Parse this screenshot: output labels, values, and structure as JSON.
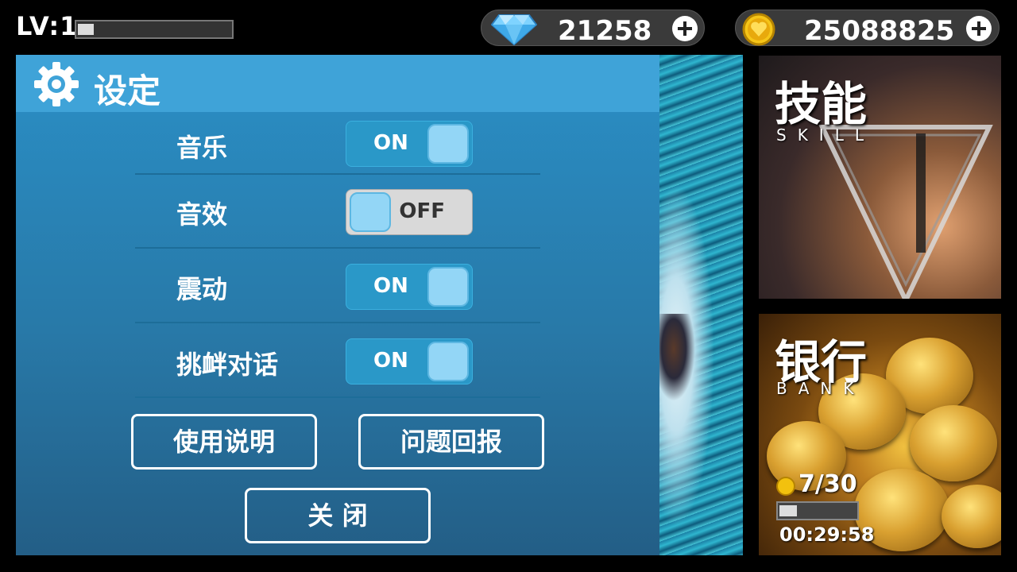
{
  "hud": {
    "level_label": "LV:1",
    "level_progress": 0.1,
    "gems": {
      "icon": "diamond-icon",
      "value": "21258"
    },
    "coins": {
      "icon": "heart-coin-icon",
      "value": "25088825"
    }
  },
  "settings": {
    "title": "设定",
    "icon": "gear-icon",
    "rows": [
      {
        "label": "音乐",
        "state": "ON"
      },
      {
        "label": "音效",
        "state": "OFF"
      },
      {
        "label": "震动",
        "state": "ON"
      },
      {
        "label": "挑衅对话",
        "state": "ON"
      }
    ],
    "buttons": {
      "help": "使用说明",
      "feedback": "问题回报",
      "close": "关 闭"
    }
  },
  "tiles": {
    "skill": {
      "title": "技能",
      "subtitle": "SKILL"
    },
    "bank": {
      "title": "银行",
      "subtitle": "BANK",
      "count": "7/30",
      "progress": 0.23,
      "timer": "00:29:58"
    }
  },
  "colors": {
    "panel_header": "#3fa3d8",
    "toggle_on": "#2a98c8",
    "toggle_off": "#d9d9d9",
    "knob": "#93d6f6"
  }
}
